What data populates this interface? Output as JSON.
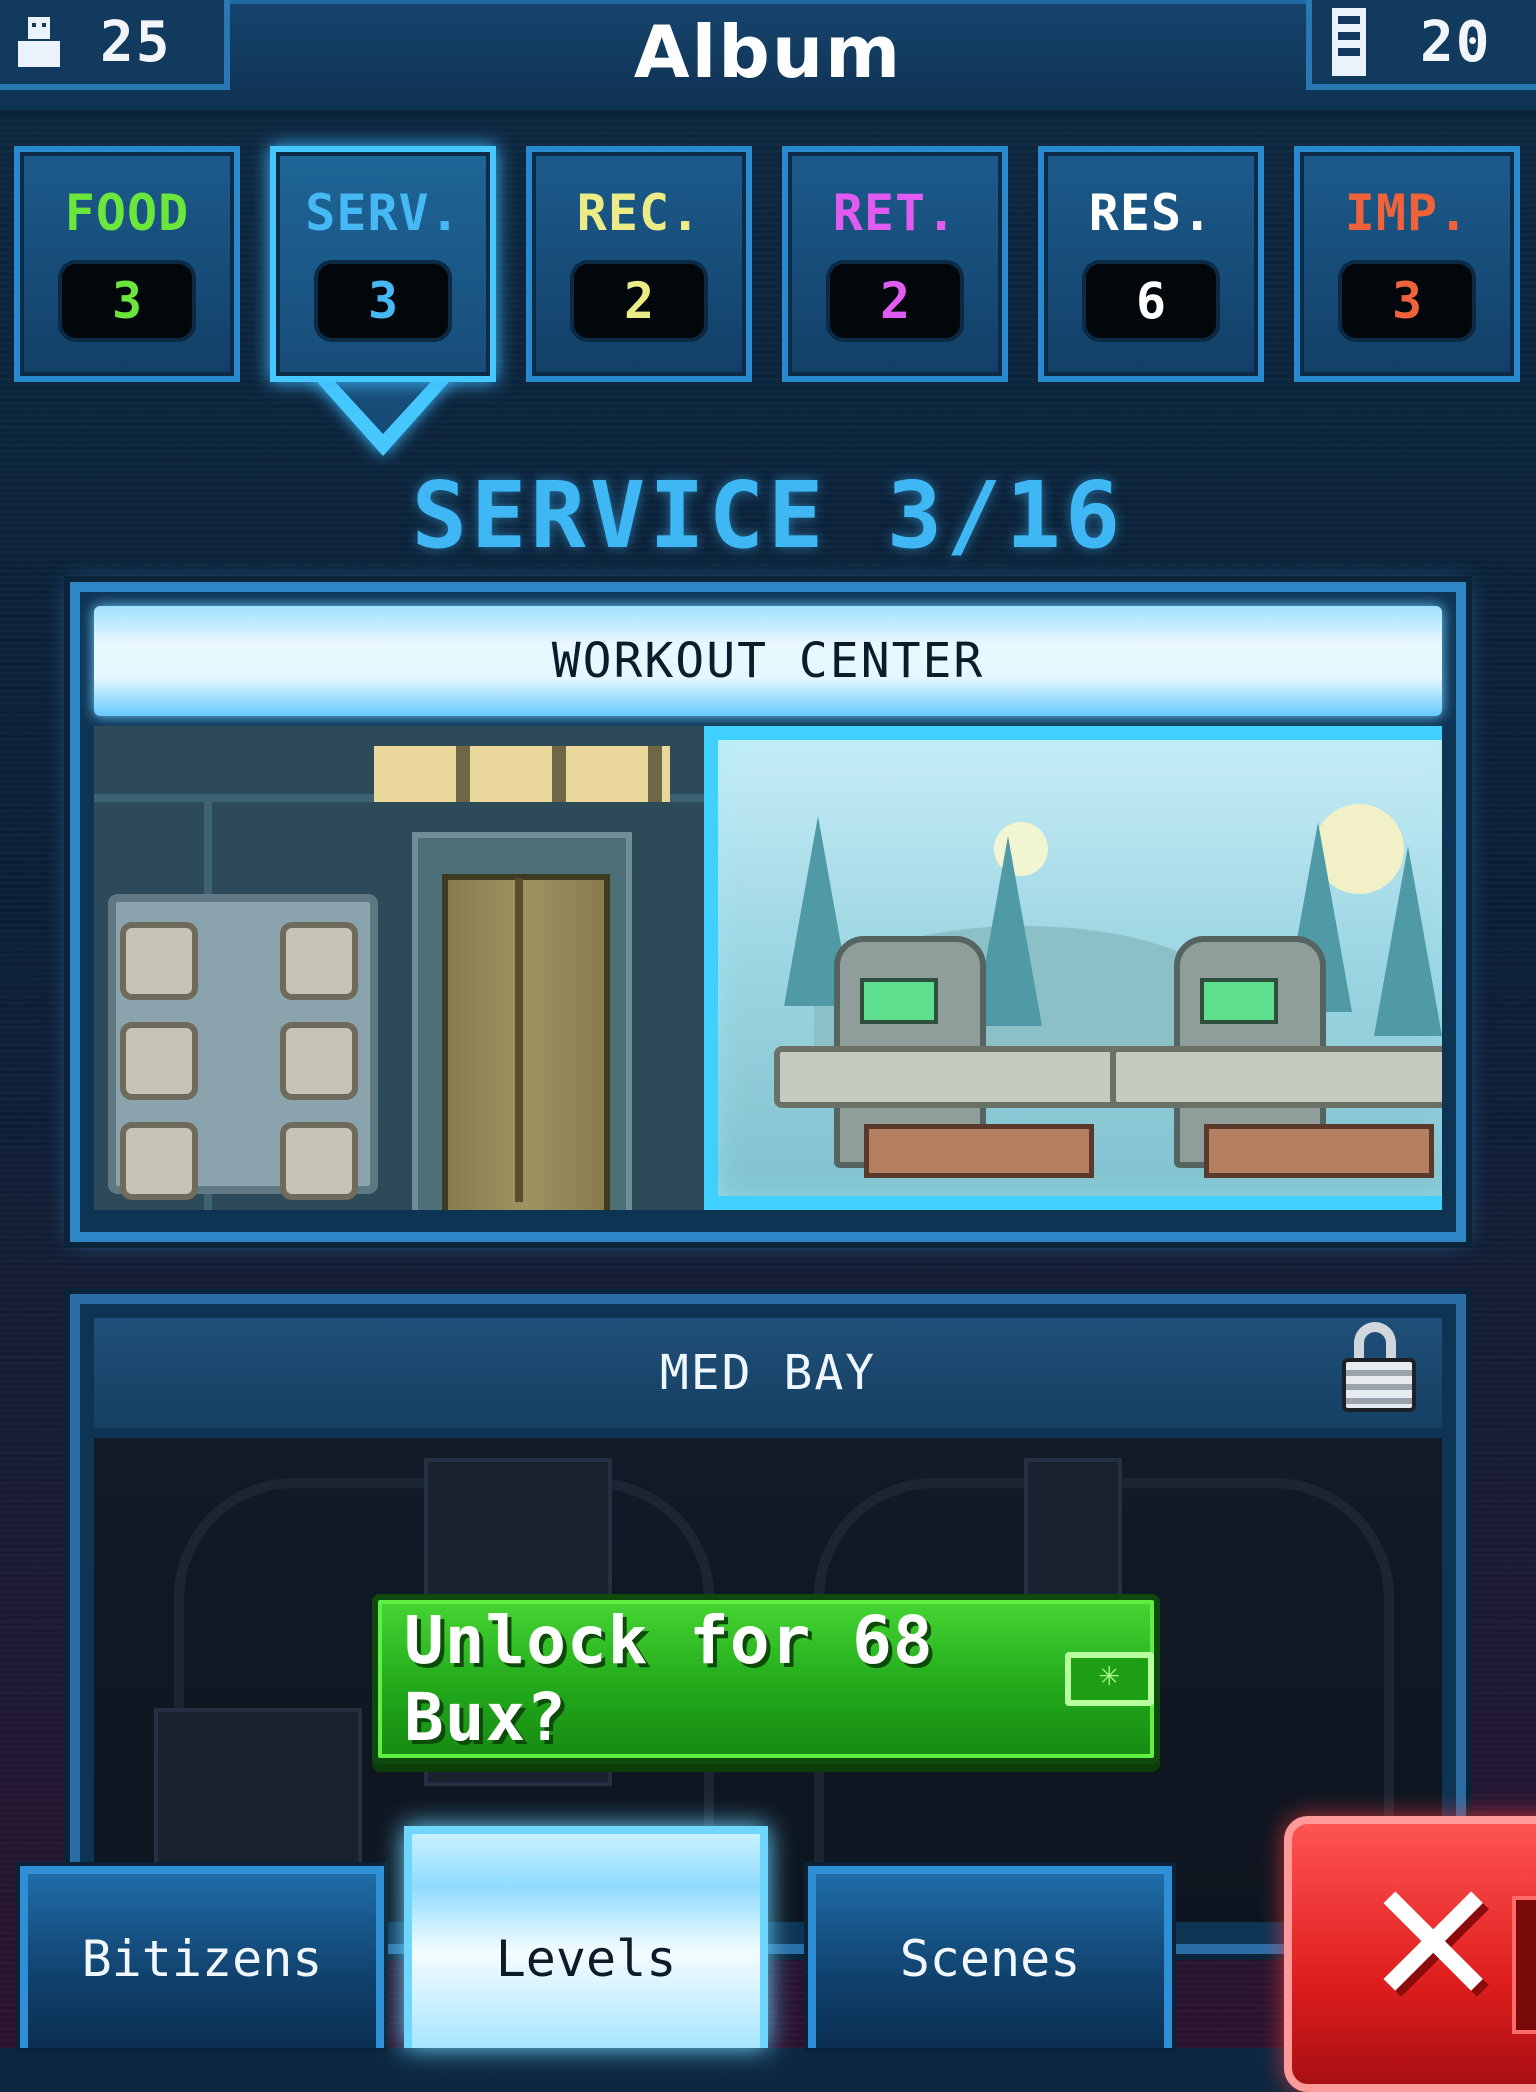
{
  "header": {
    "title": "Album",
    "bitizens_count": "25",
    "floors_count": "20"
  },
  "categories": [
    {
      "label": "FOOD",
      "count": "3",
      "color": "#6be63c"
    },
    {
      "label": "SERV.",
      "count": "3",
      "color": "#46b8f3"
    },
    {
      "label": "REC.",
      "count": "2",
      "color": "#ecec86"
    },
    {
      "label": "RET.",
      "count": "2",
      "color": "#e05cf0"
    },
    {
      "label": "RES.",
      "count": "6",
      "color": "#ffffff"
    },
    {
      "label": "IMP.",
      "count": "3",
      "color": "#f0623a"
    }
  ],
  "active_category": "SERV.",
  "section": {
    "heading": "SERVICE 3/16"
  },
  "rooms": [
    {
      "name": "WORKOUT CENTER",
      "locked": false
    },
    {
      "name": "MED BAY",
      "locked": true
    }
  ],
  "unlock_button": {
    "label": "Unlock for 68 Bux?",
    "icon": "bux-icon"
  },
  "bottom_tabs": [
    {
      "label": "Bitizens"
    },
    {
      "label": "Levels"
    },
    {
      "label": "Scenes"
    }
  ],
  "active_bottom_tab": "Levels",
  "icons": {
    "bitizen": "person-icon",
    "floors": "building-icon",
    "lock": "lock-icon",
    "close": "close-icon"
  },
  "colors": {
    "accent": "#46c8ff",
    "unlock_green": "#22a91b",
    "close_red": "#e01e1e"
  }
}
